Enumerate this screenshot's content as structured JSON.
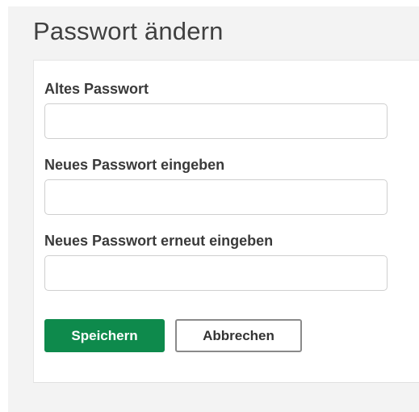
{
  "page": {
    "title": "Passwort ändern"
  },
  "form": {
    "fields": [
      {
        "label": "Altes Passwort",
        "value": "",
        "placeholder": ""
      },
      {
        "label": "Neues Passwort eingeben",
        "value": "",
        "placeholder": ""
      },
      {
        "label": "Neues Passwort erneut eingeben",
        "value": "",
        "placeholder": ""
      }
    ],
    "buttons": {
      "save_label": "Speichern",
      "cancel_label": "Abbrechen"
    }
  },
  "colors": {
    "primary": "#0e8a4c",
    "panel_background": "#f3f3f3",
    "card_background": "#ffffff",
    "text": "#3a3a3a"
  }
}
